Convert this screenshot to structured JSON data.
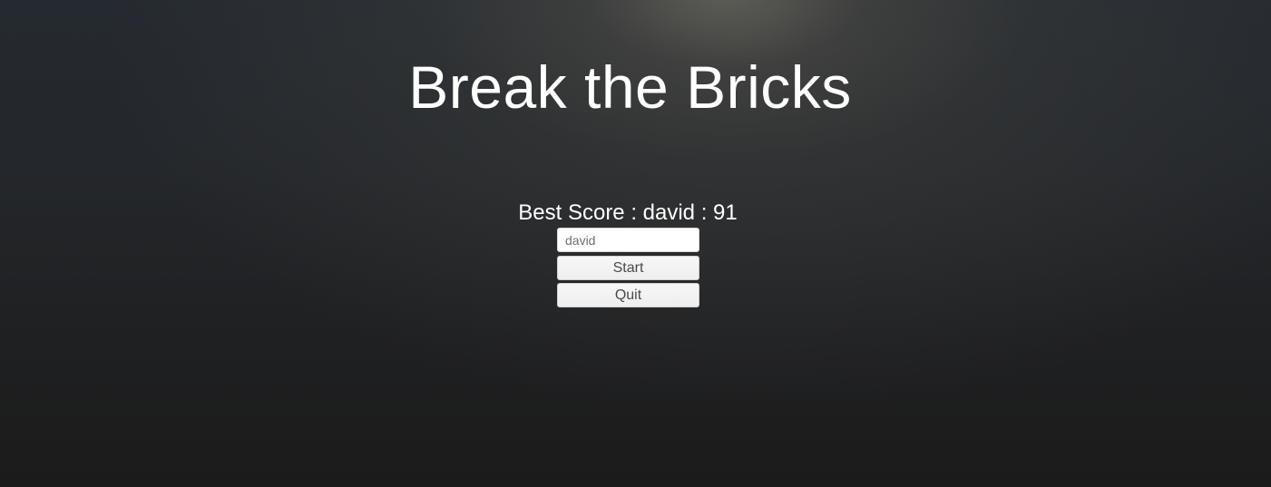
{
  "title": "Break the Bricks",
  "best_score": {
    "label": "Best Score : david : 91",
    "player": "david",
    "score": 91
  },
  "name_input": {
    "value": "david",
    "placeholder": ""
  },
  "buttons": {
    "start_label": "Start",
    "quit_label": "Quit"
  },
  "colors": {
    "text": "#ffffff",
    "button_bg": "#f2f2f2",
    "button_text": "#4a4a4a",
    "background_dark": "#1b1b1b"
  }
}
